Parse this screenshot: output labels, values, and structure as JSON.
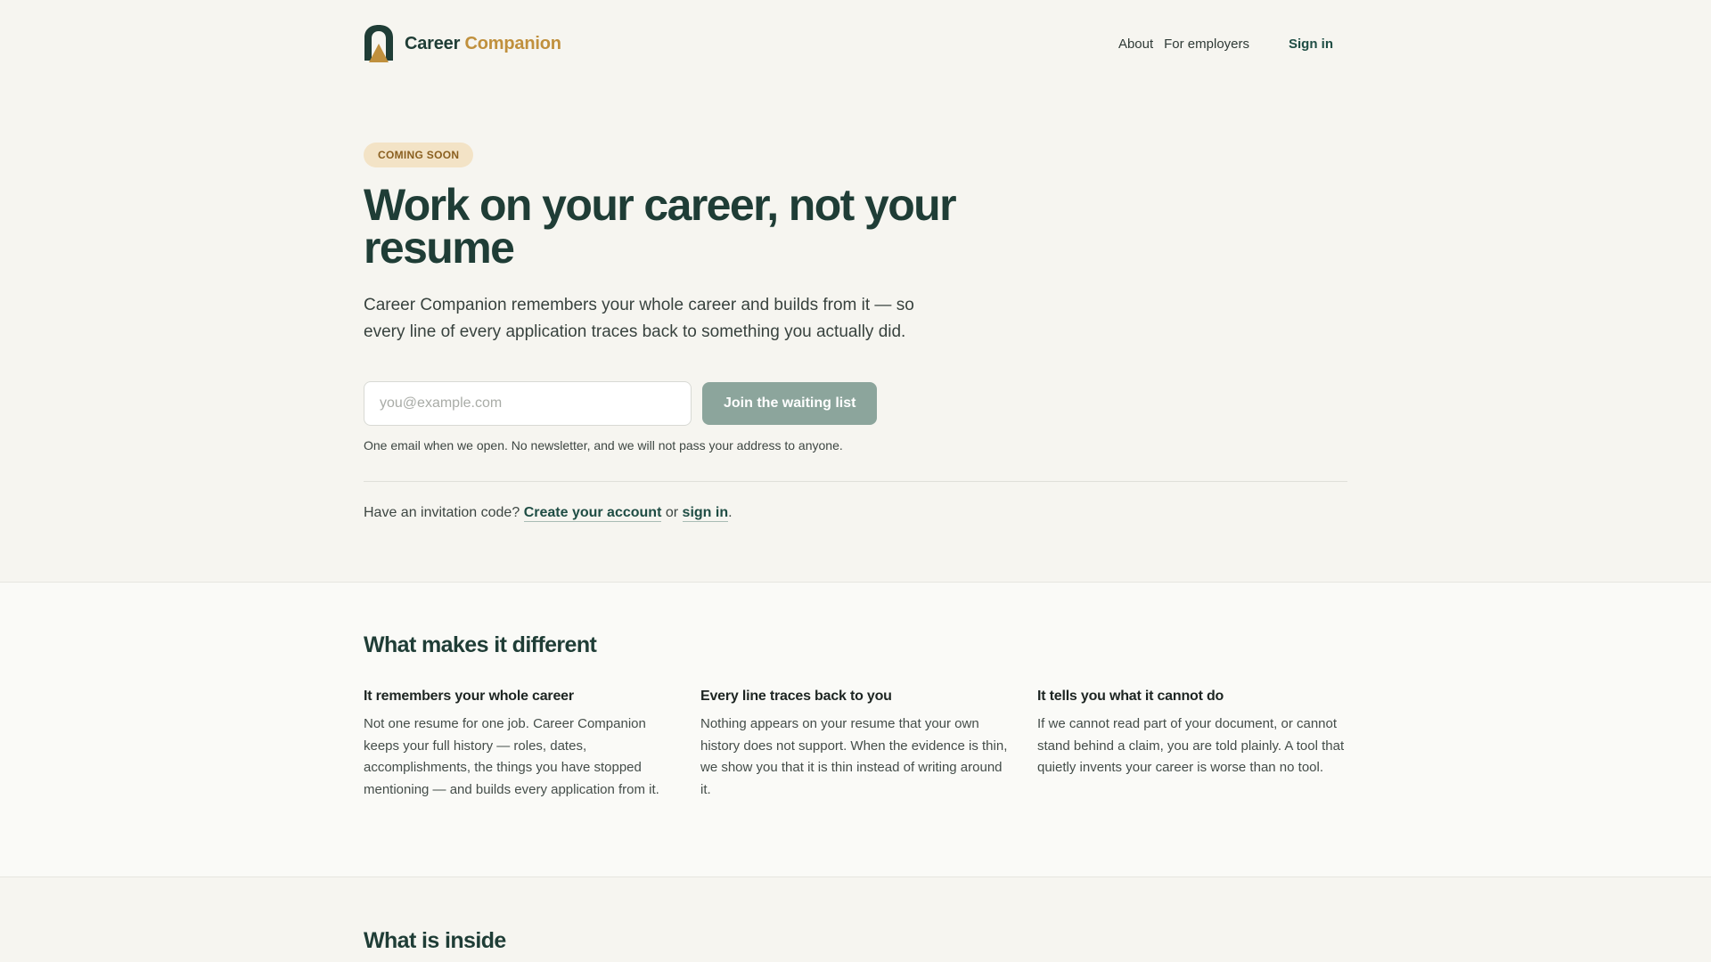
{
  "header": {
    "brand_word1": "Career",
    "brand_word2": "Companion",
    "nav": {
      "about": "About",
      "employers": "For employers",
      "sign_in": "Sign in"
    }
  },
  "hero": {
    "badge": "COMING SOON",
    "title": "Work on your career, not your resume",
    "subtitle": "Career Companion remembers your whole career and builds from it — so every line of every application traces back to something you actually did.",
    "email_placeholder": "you@example.com",
    "email_value": "",
    "join_label": "Join the waiting list",
    "fine_print": "One email when we open. No newsletter, and we will not pass your address to anyone.",
    "invite_prefix": "Have an invitation code?",
    "invite_create": "Create your account",
    "invite_or": "or",
    "invite_signin": "sign in",
    "invite_suffix": "."
  },
  "different": {
    "title": "What makes it different",
    "features": [
      {
        "title": "It remembers your whole career",
        "text": "Not one resume for one job. Career Companion keeps your full history — roles, dates, accomplishments, the things you have stopped mentioning — and builds every application from it."
      },
      {
        "title": "Every line traces back to you",
        "text": "Nothing appears on your resume that your own history does not support. When the evidence is thin, we show you that it is thin instead of writing around it."
      },
      {
        "title": "It tells you what it cannot do",
        "text": "If we cannot read part of your document, or cannot stand behind a claim, you are told plainly. A tool that quietly invents your career is worse than no tool."
      }
    ]
  },
  "inside": {
    "title": "What is inside"
  },
  "colors": {
    "page_bg": "#f6f5f0",
    "brand_green": "#1f3d36",
    "brand_gold": "#c0903d",
    "button_bg": "#8ca59c",
    "badge_bg": "#f3e3c6",
    "badge_text": "#8a5f1f"
  },
  "icons": {
    "logo": "career-companion-logo-icon"
  }
}
